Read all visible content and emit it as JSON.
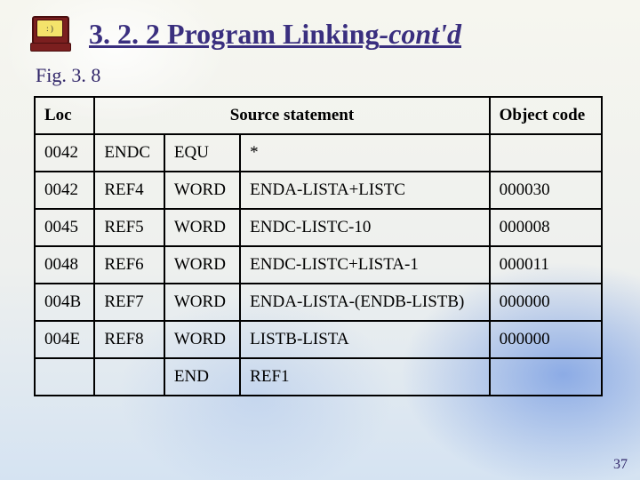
{
  "title_main": "3. 2. 2 Program Linking",
  "title_suffix": "-cont'd",
  "figure_label": "Fig. 3. 8",
  "icon_face": ": )",
  "page_number": "37",
  "table": {
    "headers": {
      "loc": "Loc",
      "source": "Source statement",
      "obj": "Object code"
    },
    "rows": [
      {
        "loc": "0042",
        "c1": "ENDC",
        "c2": "EQU",
        "c3": "*",
        "obj": ""
      },
      {
        "loc": "0042",
        "c1": "REF4",
        "c2": "WORD",
        "c3": "ENDA-LISTA+LISTC",
        "obj": "000030"
      },
      {
        "loc": "0045",
        "c1": "REF5",
        "c2": "WORD",
        "c3": "ENDC-LISTC-10",
        "obj": "000008"
      },
      {
        "loc": "0048",
        "c1": "REF6",
        "c2": "WORD",
        "c3": "ENDC-LISTC+LISTA-1",
        "obj": "000011"
      },
      {
        "loc": "004B",
        "c1": "REF7",
        "c2": "WORD",
        "c3": "ENDA-LISTA-(ENDB-LISTB)",
        "obj": "000000"
      },
      {
        "loc": "004E",
        "c1": "REF8",
        "c2": "WORD",
        "c3": "LISTB-LISTA",
        "obj": "000000"
      },
      {
        "loc": "",
        "c1": "",
        "c2": "END",
        "c3": "REF1",
        "obj": ""
      }
    ]
  }
}
